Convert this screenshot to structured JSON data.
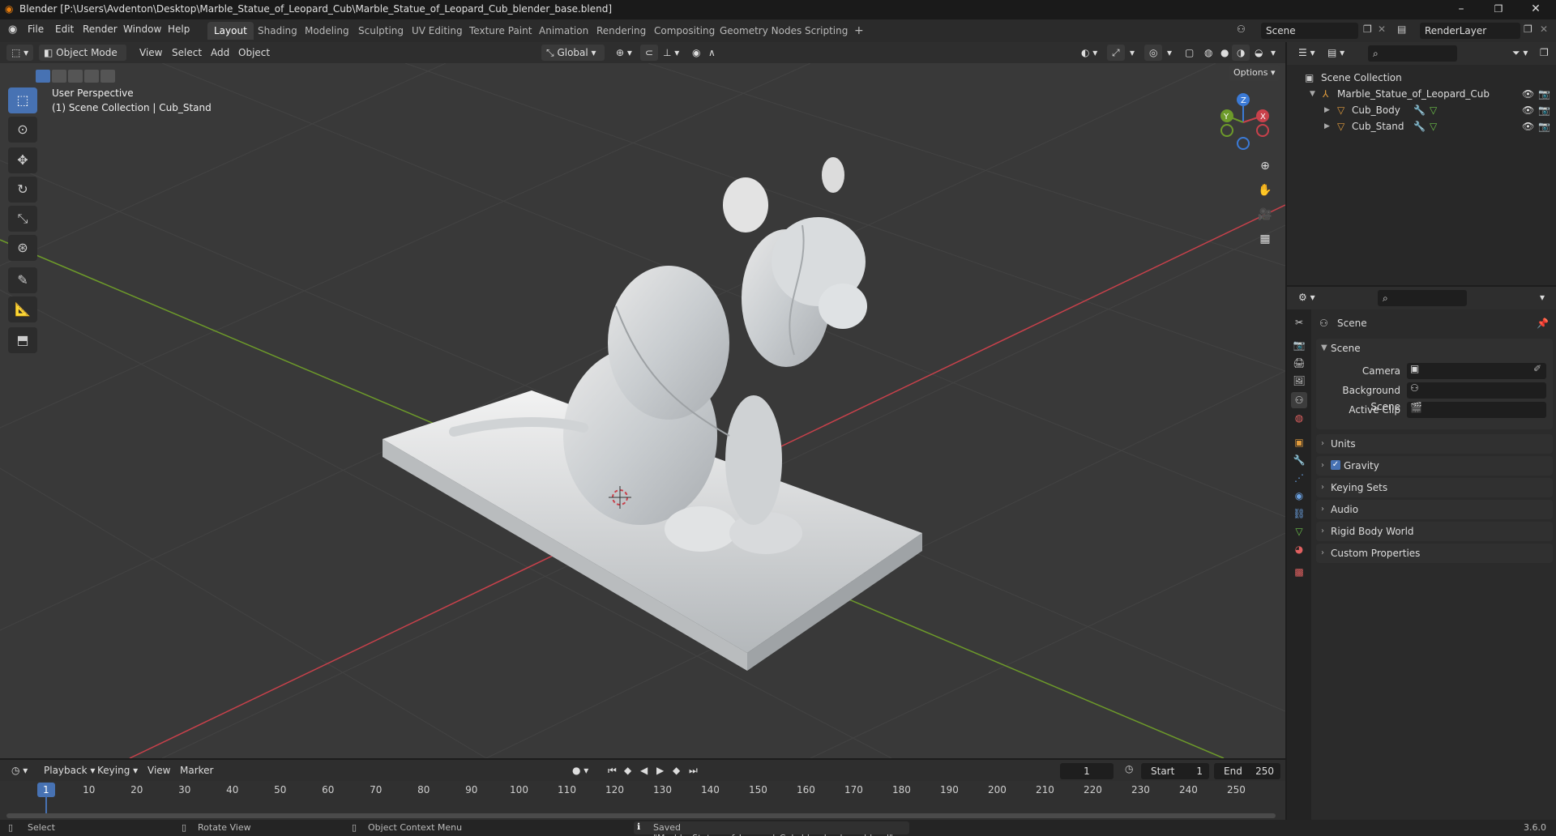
{
  "window": {
    "title": "Blender [P:\\Users\\Avdenton\\Desktop\\Marble_Statue_of_Leopard_Cub\\Marble_Statue_of_Leopard_Cub_blender_base.blend]",
    "minimize": "–",
    "maximize": "❐",
    "close": "✕"
  },
  "menu": [
    "File",
    "Edit",
    "Render",
    "Window",
    "Help"
  ],
  "workspaces": [
    {
      "label": "Layout",
      "active": true
    },
    {
      "label": "Shading"
    },
    {
      "label": "Modeling"
    },
    {
      "label": "Sculpting"
    },
    {
      "label": "UV Editing"
    },
    {
      "label": "Texture Paint"
    },
    {
      "label": "Animation"
    },
    {
      "label": "Rendering"
    },
    {
      "label": "Compositing"
    },
    {
      "label": "Geometry Nodes"
    },
    {
      "label": "Scripting"
    }
  ],
  "workspace_add": "+",
  "scene_field": "Scene",
  "renderlayer_field": "RenderLayer",
  "viewport_header": {
    "mode": "Object Mode",
    "menus": [
      "View",
      "Select",
      "Add",
      "Object"
    ],
    "orientation": "Global",
    "options": "Options"
  },
  "viewport": {
    "perspective": "User Perspective",
    "collection_info": "(1) Scene Collection | Cub_Stand",
    "gizmo": {
      "x": "X",
      "y": "Y",
      "z": "Z"
    }
  },
  "outliner": {
    "root": "Scene Collection",
    "collection": "Marble_Statue_of_Leopard_Cub",
    "objects": [
      "Cub_Body",
      "Cub_Stand"
    ]
  },
  "properties": {
    "context": "Scene",
    "panel_scene": "Scene",
    "rows": [
      {
        "label": "Camera"
      },
      {
        "label": "Background Scene"
      },
      {
        "label": "Active Clip"
      }
    ],
    "panels": [
      "Units",
      "Gravity",
      "Keying Sets",
      "Audio",
      "Rigid Body World",
      "Custom Properties"
    ],
    "gravity_checked": true
  },
  "timeline": {
    "menus": [
      "Playback",
      "Keying",
      "View",
      "Marker"
    ],
    "current_frame": "1",
    "start_label": "Start",
    "start": "1",
    "end_label": "End",
    "end": "250",
    "ticks": [
      "1",
      "10",
      "20",
      "30",
      "40",
      "50",
      "60",
      "70",
      "80",
      "90",
      "100",
      "110",
      "120",
      "130",
      "140",
      "150",
      "160",
      "170",
      "180",
      "190",
      "200",
      "210",
      "220",
      "230",
      "240",
      "250"
    ]
  },
  "statusbar": {
    "select": "Select",
    "rotate": "Rotate View",
    "context_menu": "Object Context Menu",
    "message": "Saved \"Marble_Statue_of_Leopard_Cub_blender_base.blend\"",
    "version": "3.6.0"
  },
  "colors": {
    "accent": "#4772b3",
    "x_axis": "#c8414b",
    "y_axis": "#6d9a2a",
    "z_axis": "#3b7ad6",
    "orange": "#e09b3d"
  }
}
